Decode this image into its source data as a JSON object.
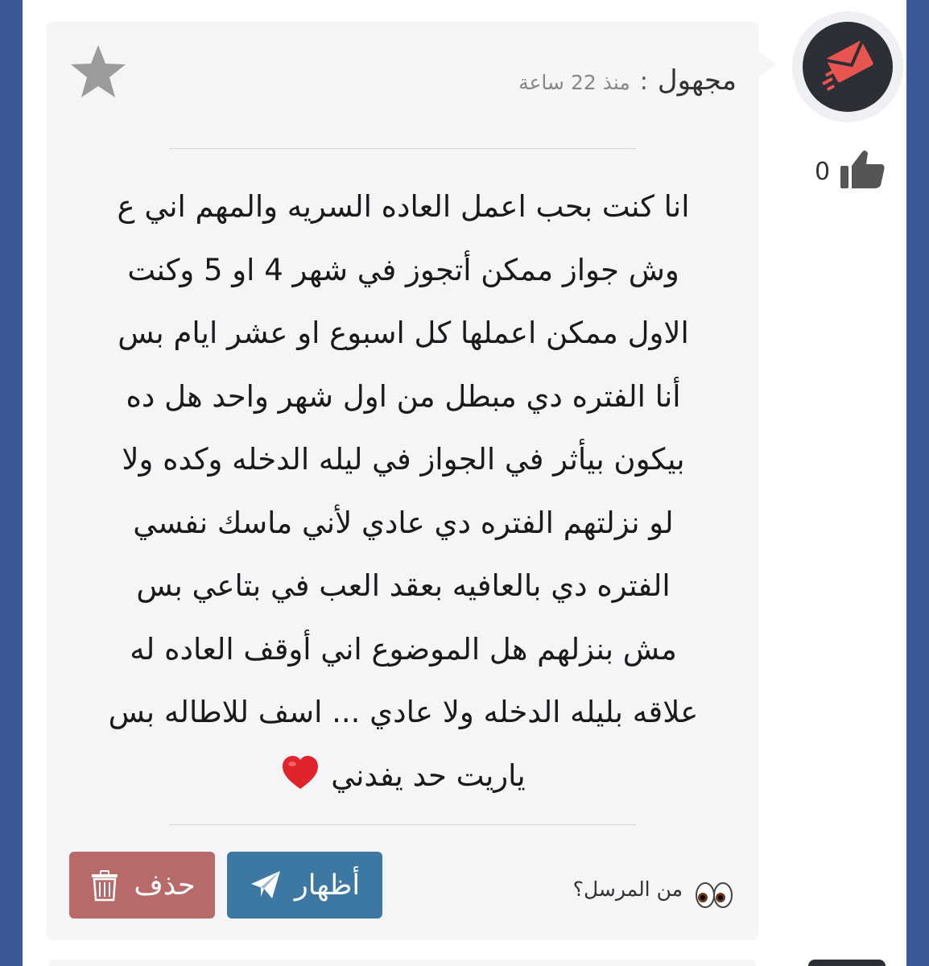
{
  "post": {
    "author": "مجهول",
    "separator": ":",
    "time": "منذ 22 ساعة",
    "likes": "0",
    "message_lines": [
      "انا كنت بحب اعمل العاده السريه والمهم اني ع",
      "وش جواز ممكن أتجوز في شهر 4 او 5 وكنت",
      "الاول ممكن اعملها كل اسبوع او عشر ايام بس",
      "أنا الفتره دي مبطل من اول شهر واحد هل ده",
      "بيكون بيأثر في الجواز في ليله الدخله وكده ولا",
      "لو نزلتهم الفتره دي عادي لأني ماسك نفسي",
      "الفتره دي بالعافيه بعقد العب في بتاعي بس",
      "مش بنزلهم هل الموضوع اني أوقف العاده له",
      "علاقه بليله الدخله ولا عادي ... اسف للاطاله بس",
      "ياريت حد يفدني"
    ],
    "sender_label": "من المرسل؟",
    "show_button": "أظهار",
    "delete_button": "حذف"
  },
  "icons": {
    "avatar": "envelope-logo-icon",
    "like": "thumbs-up-icon",
    "favorite": "star-icon",
    "heart": "red-heart-emoji",
    "sender": "eyes-emoji",
    "send": "paper-plane-icon",
    "delete": "trash-icon"
  },
  "colors": {
    "frame": "#3b5998",
    "card": "#f5f5f7",
    "show_button": "#3d78a3",
    "delete_button": "#b86a6a",
    "avatar_bg": "#2d2f36",
    "avatar_accent": "#e8544f"
  }
}
